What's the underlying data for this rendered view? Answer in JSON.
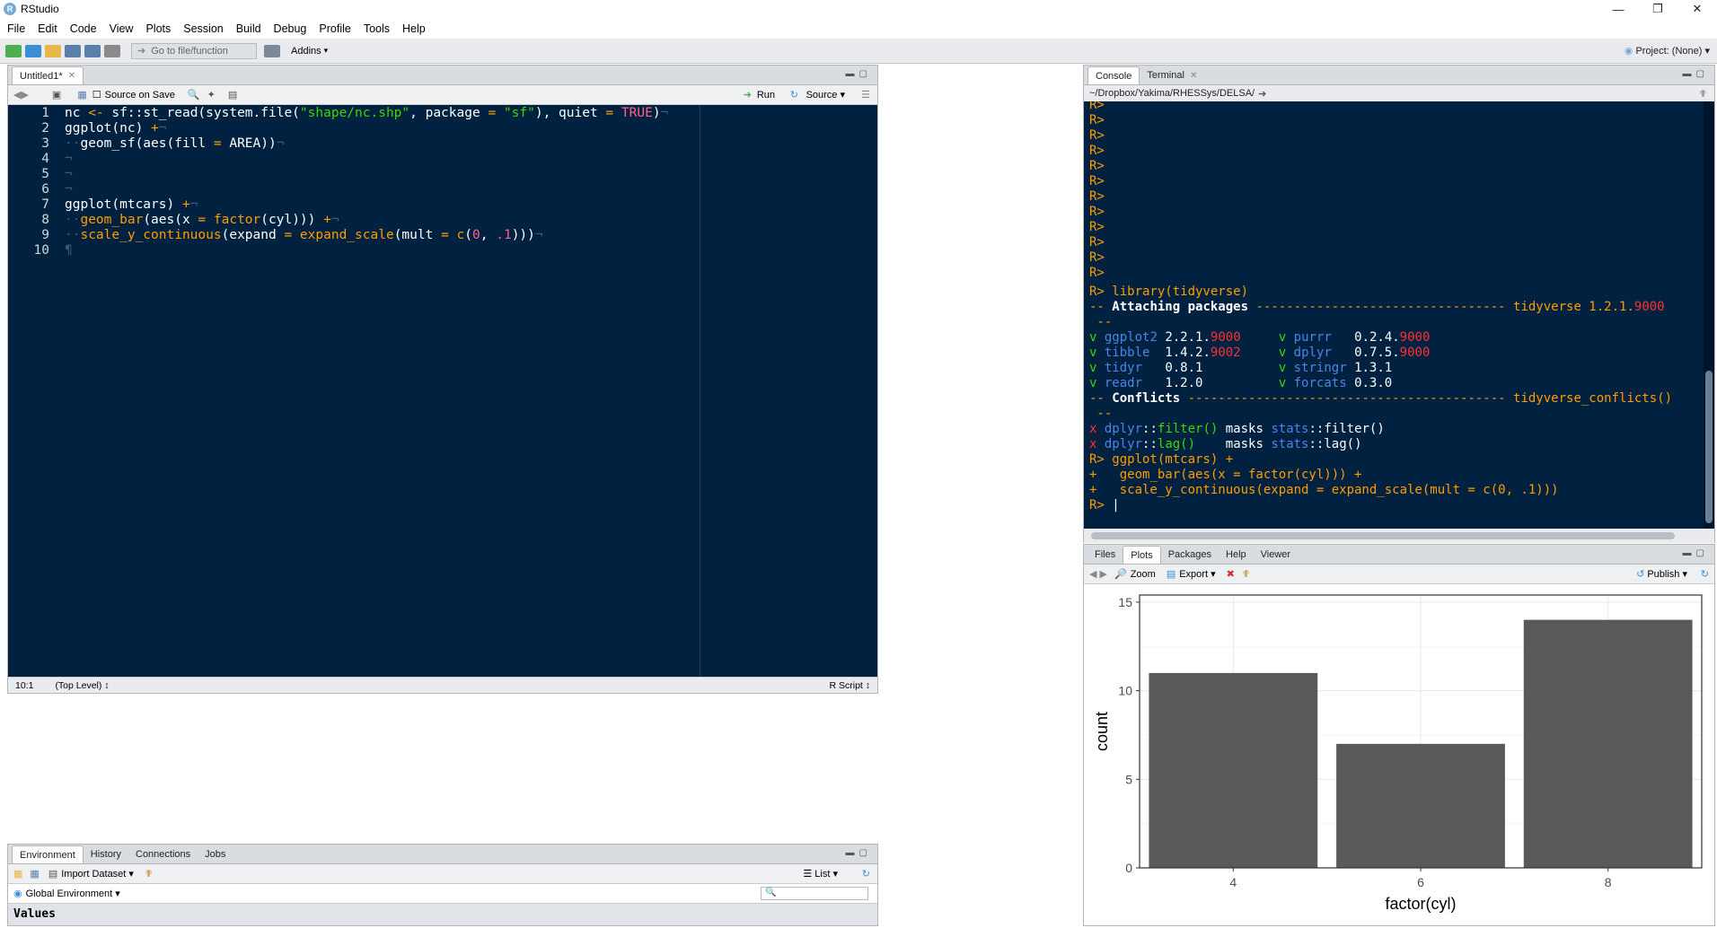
{
  "window": {
    "title": "RStudio"
  },
  "menu": [
    "File",
    "Edit",
    "Code",
    "View",
    "Plots",
    "Session",
    "Build",
    "Debug",
    "Profile",
    "Tools",
    "Help"
  ],
  "toolbar": {
    "goto_label": "Go to file/function",
    "addins_label": "Addins",
    "project_label": "Project: (None)"
  },
  "source": {
    "tab_label": "Untitled1*",
    "source_on_save": "Source on Save",
    "run_label": "Run",
    "source_label": "Source",
    "line_numbers": [
      "1",
      "2",
      "3",
      "4",
      "5",
      "6",
      "7",
      "8",
      "9",
      "10"
    ],
    "status_position": "10:1",
    "status_scope": "(Top Level)",
    "status_type": "R Script"
  },
  "env": {
    "tabs": [
      "Environment",
      "History",
      "Connections",
      "Jobs"
    ],
    "import_label": "Import Dataset",
    "list_label": "List",
    "global_env": "Global Environment",
    "values_label": "Values"
  },
  "console": {
    "tabs": [
      "Console",
      "Terminal"
    ],
    "path": "~/Dropbox/Yakima/RHESSys/DELSA/",
    "empty_prompts": 12,
    "lines": [
      "R> library(tidyverse)",
      "-- Attaching packages --------------------------------- tidyverse 1.2.1.9000",
      " --",
      "v ggplot2 2.2.1.9000     v purrr   0.2.4.9000",
      "v tibble  1.4.2.9002     v dplyr   0.7.5.9000",
      "v tidyr   0.8.1          v stringr 1.3.1",
      "v readr   1.2.0          v forcats 0.3.0",
      "-- Conflicts ------------------------------------------ tidyverse_conflicts()",
      " --",
      "x dplyr::filter() masks stats::filter()",
      "x dplyr::lag()    masks stats::lag()",
      "R> ggplot(mtcars) +",
      "+   geom_bar(aes(x = factor(cyl))) +",
      "+   scale_y_continuous(expand = expand_scale(mult = c(0, .1)))",
      "R> "
    ]
  },
  "files": {
    "tabs": [
      "Files",
      "Plots",
      "Packages",
      "Help",
      "Viewer"
    ],
    "zoom_label": "Zoom",
    "export_label": "Export",
    "publish_label": "Publish"
  },
  "chart_data": {
    "type": "bar",
    "categories": [
      "4",
      "6",
      "8"
    ],
    "values": [
      11,
      7,
      14
    ],
    "title": "",
    "xlabel": "factor(cyl)",
    "ylabel": "count",
    "ylim": [
      0,
      15.4
    ],
    "yticks": [
      0,
      5,
      10,
      15
    ],
    "bar_color": "#595959",
    "grid": true
  }
}
